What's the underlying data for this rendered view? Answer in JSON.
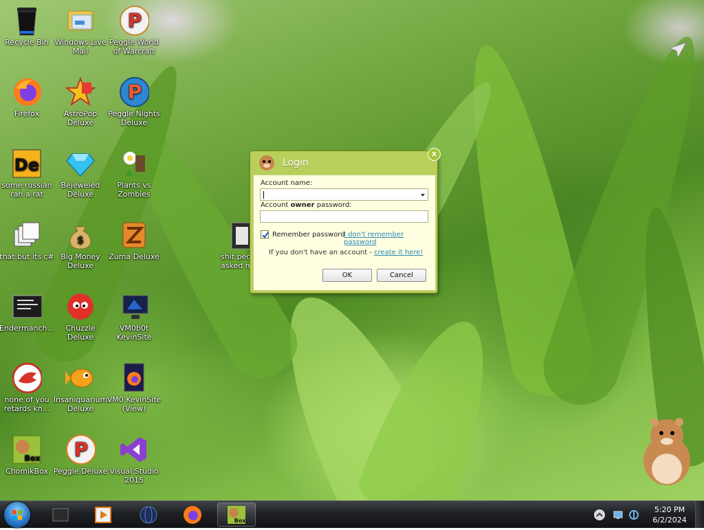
{
  "desktop": {
    "icons": [
      {
        "name": "recycle-bin",
        "label": "Recycle Bin"
      },
      {
        "name": "windows-live-mail",
        "label": "Windows Live Mail"
      },
      {
        "name": "peggle-world-of-warcraft",
        "label": "Peggle World of Warcraft"
      },
      {
        "name": "firefox",
        "label": "Firefox"
      },
      {
        "name": "astropop-deluxe",
        "label": "AstroPop Deluxe"
      },
      {
        "name": "peggle-nights-deluxe",
        "label": "Peggle Nights Deluxe"
      },
      {
        "name": "some-russian-ran-a-rat",
        "label": "some russian ran a rat"
      },
      {
        "name": "bejeweled-deluxe",
        "label": "Bejeweled Deluxe"
      },
      {
        "name": "plants-vs-zombies",
        "label": "Plants vs Zombies"
      },
      {
        "name": "that-but-its-csharp",
        "label": "that but its c#"
      },
      {
        "name": "big-money-deluxe",
        "label": "Big Money Deluxe"
      },
      {
        "name": "zuma-deluxe",
        "label": "Zuma Deluxe"
      },
      {
        "name": "endermanch",
        "label": "Endermanch..."
      },
      {
        "name": "chuzzle-deluxe",
        "label": "Chuzzle Deluxe"
      },
      {
        "name": "vm0b0t-kevinsite",
        "label": "VM0b0t KevinSite"
      },
      {
        "name": "none-of-you-retards",
        "label": "none of you retards kn..."
      },
      {
        "name": "insaniquarium-deluxe",
        "label": "Insaniquarium Deluxe"
      },
      {
        "name": "vm0-kevinsite-view",
        "label": "VM0 KevinSite (View)"
      },
      {
        "name": "chomikbox",
        "label": "ChomikBox"
      },
      {
        "name": "peggle-deluxe",
        "label": "Peggle Deluxe"
      },
      {
        "name": "visual-studio-2015",
        "label": "Visual Studio 2015"
      },
      {
        "name": "shit-people-asked",
        "label": "shit peo asked m"
      }
    ]
  },
  "dialog": {
    "title": "Login",
    "close_label": "x",
    "account_name_label": "Account name:",
    "account_name_value": "",
    "password_label_pre": "Account ",
    "password_label_bold": "owner",
    "password_label_post": " password:",
    "password_value": "",
    "remember_label": "Remember password",
    "remember_checked": true,
    "forgot_link": "I don't remember password",
    "no_account_text": "If you don't have an account - ",
    "create_link": "create it here!",
    "ok_label": "OK",
    "cancel_label": "Cancel"
  },
  "taskbar": {
    "clock_time": "5:20 PM",
    "clock_date": "6/2/2024"
  },
  "colors": {
    "dialog_frame": "#b9cf5c",
    "dialog_body": "#fffee0",
    "link": "#2a8ab8",
    "taskbar": "#1f2124"
  }
}
